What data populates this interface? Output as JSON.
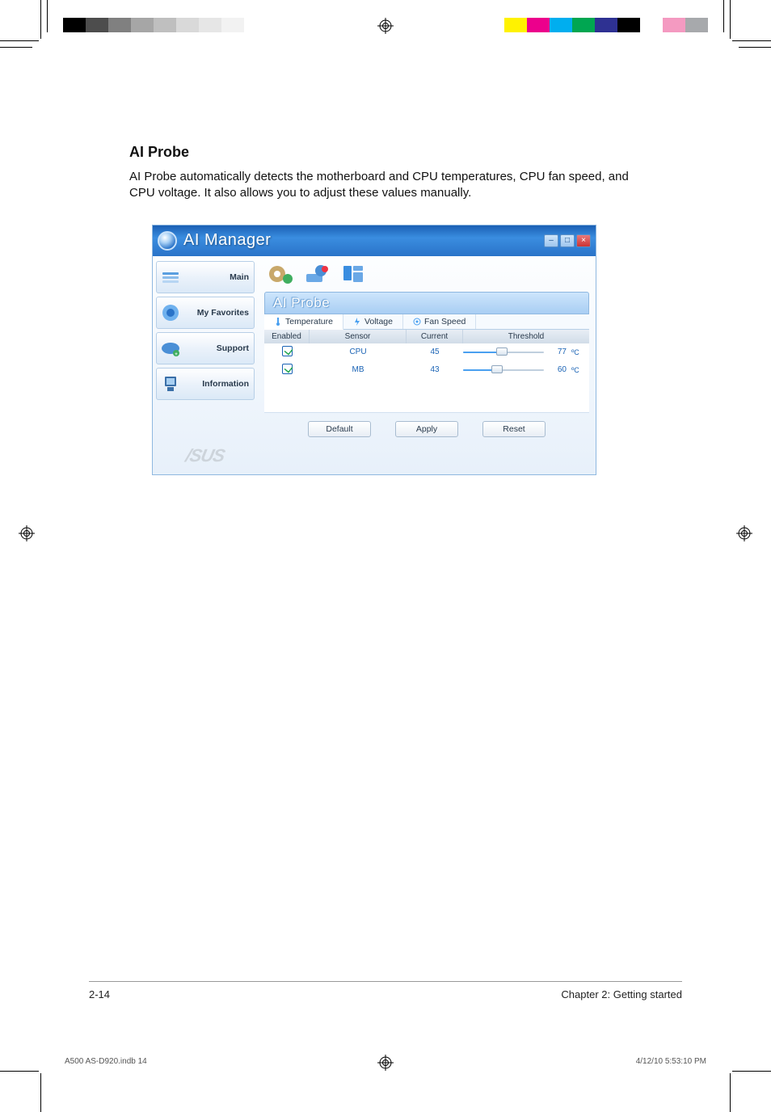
{
  "doc": {
    "section_title": "AI Probe",
    "section_body": "AI Probe automatically detects the motherboard and CPU temperatures, CPU fan speed, and CPU voltage. It also allows you to adjust these values manually.",
    "page_number": "2-14",
    "chapter": "Chapter 2: Getting started",
    "indb_file": "A500 AS-D920.indb   14",
    "indb_stamp": "4/12/10   5:53:10 PM"
  },
  "app": {
    "title": "AI Manager",
    "win_buttons": {
      "min": "–",
      "max": "□",
      "close": "×"
    },
    "sidebar": [
      {
        "label": "Main"
      },
      {
        "label": "My Favorites"
      },
      {
        "label": "Support"
      },
      {
        "label": "Information"
      }
    ],
    "brand": "/SUS",
    "pane_title": "AI Probe",
    "tabs": [
      {
        "label": "Temperature",
        "active": true
      },
      {
        "label": "Voltage",
        "active": false
      },
      {
        "label": "Fan Speed",
        "active": false
      }
    ],
    "columns": {
      "enabled": "Enabled",
      "sensor": "Sensor",
      "current": "Current",
      "threshold": "Threshold"
    },
    "rows": [
      {
        "enabled": true,
        "sensor": "CPU",
        "current": "45",
        "threshold": "77",
        "unit": "ºC",
        "fill_pct": 48
      },
      {
        "enabled": true,
        "sensor": "MB",
        "current": "43",
        "threshold": "60",
        "unit": "ºC",
        "fill_pct": 42
      }
    ],
    "buttons": {
      "default": "Default",
      "apply": "Apply",
      "reset": "Reset"
    }
  },
  "print_marks": {
    "left_swatches": [
      "#000000",
      "#4d4d4d",
      "#808080",
      "#a6a6a6",
      "#bfbfbf",
      "#d9d9d9",
      "#e6e6e6",
      "#f2f2f2",
      "#ffffff"
    ],
    "right_swatches": [
      "#fff200",
      "#ec008c",
      "#00aeef",
      "#00a651",
      "#2e3192",
      "#000000",
      "#ffffff",
      "#f49ac1",
      "#a7a9ac"
    ]
  }
}
